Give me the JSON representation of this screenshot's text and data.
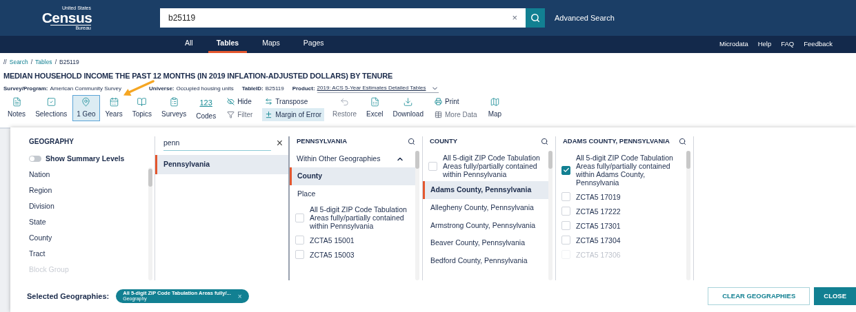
{
  "header": {
    "logo": {
      "top": "United States",
      "main": "Census",
      "bottom": "Bureau"
    },
    "search": {
      "value": "b25119",
      "clear": "×"
    },
    "advanced": "Advanced Search"
  },
  "nav": {
    "tabs": [
      {
        "label": "All",
        "selected": false
      },
      {
        "label": "Tables",
        "selected": true
      },
      {
        "label": "Maps",
        "selected": false
      },
      {
        "label": "Pages",
        "selected": false
      }
    ],
    "links": [
      "Microdata",
      "Help",
      "FAQ",
      "Feedback"
    ]
  },
  "breadcrumb": {
    "prefix": "//",
    "separator": "/",
    "items": [
      "Search",
      "Tables"
    ],
    "current": "B25119"
  },
  "title": "MEDIAN HOUSEHOLD INCOME THE PAST 12 MONTHS (IN 2019 INFLATION-ADJUSTED DOLLARS) BY TENURE",
  "meta": [
    {
      "label": "Survey/Program:",
      "value": "American Community Survey",
      "kind": "text"
    },
    {
      "label": "Universe:",
      "value": "Occupied housing units",
      "kind": "text"
    },
    {
      "label": "TableID:",
      "value": "B25119",
      "kind": "text"
    },
    {
      "label": "Product:",
      "value": "2019: ACS 5-Year Estimates Detailed Tables",
      "kind": "dropdown"
    }
  ],
  "toolbar": [
    {
      "kind": "tool",
      "label": "Notes",
      "selected": false,
      "disabled": false
    },
    {
      "kind": "tool",
      "label": "Selections",
      "selected": false,
      "disabled": false
    },
    {
      "kind": "tool",
      "label": "1 Geo",
      "selected": true,
      "disabled": false
    },
    {
      "kind": "tool",
      "label": "Years",
      "selected": false,
      "disabled": false
    },
    {
      "kind": "tool",
      "label": "Topics",
      "selected": false,
      "disabled": false
    },
    {
      "kind": "tool",
      "label": "Surveys",
      "selected": false,
      "disabled": false
    },
    {
      "kind": "code",
      "label": "Codes",
      "icon_text": "123",
      "selected": false,
      "disabled": false
    },
    {
      "kind": "stack",
      "items": [
        {
          "label": "Hide",
          "selected": false,
          "disabled": false
        },
        {
          "label": "Filter",
          "selected": false,
          "disabled": true
        }
      ]
    },
    {
      "kind": "stack",
      "items": [
        {
          "label": "Transpose",
          "selected": false,
          "disabled": false
        },
        {
          "label": "Margin of Error",
          "selected": true,
          "disabled": false
        }
      ]
    },
    {
      "kind": "tool",
      "label": "Restore",
      "selected": false,
      "disabled": true
    },
    {
      "kind": "tool",
      "label": "Excel",
      "selected": false,
      "disabled": false
    },
    {
      "kind": "tool",
      "label": "Download",
      "selected": false,
      "disabled": false
    },
    {
      "kind": "stack",
      "items": [
        {
          "label": "Print",
          "selected": false,
          "disabled": false
        },
        {
          "label": "More Data",
          "selected": false,
          "disabled": true
        }
      ]
    },
    {
      "kind": "tool",
      "label": "Map",
      "selected": false,
      "disabled": false
    }
  ],
  "geography": {
    "title": "GEOGRAPHY",
    "toggle": {
      "label": "Show Summary Levels",
      "on": false
    },
    "items": [
      {
        "label": "Nation",
        "dimmed": false
      },
      {
        "label": "Region",
        "dimmed": false
      },
      {
        "label": "Division",
        "dimmed": false
      },
      {
        "label": "State",
        "dimmed": false
      },
      {
        "label": "County",
        "dimmed": false
      },
      {
        "label": "Tract",
        "dimmed": false
      },
      {
        "label": "Block Group",
        "dimmed": true
      }
    ]
  },
  "filter": {
    "value": "penn",
    "clear": "×",
    "results": [
      {
        "label": "Pennsylvania",
        "selected": true
      }
    ]
  },
  "columns": [
    {
      "title": "PENNSYLVANIA",
      "group": {
        "label": "Within Other Geographies",
        "expanded": true
      },
      "items": [
        {
          "kind": "option",
          "label": "County",
          "selected": true,
          "dimmed": false
        },
        {
          "kind": "option",
          "label": "Place",
          "selected": false,
          "dimmed": false
        },
        {
          "kind": "check",
          "label": "All 5-digit ZIP Code Tabulation Areas fully/partially contained within Pennsylvania",
          "checked": false,
          "dimmed": false
        },
        {
          "kind": "check",
          "label": "ZCTA5 15001",
          "checked": false,
          "dimmed": false
        },
        {
          "kind": "check",
          "label": "ZCTA5 15003",
          "checked": false,
          "dimmed": false
        }
      ]
    },
    {
      "title": "COUNTY",
      "items": [
        {
          "kind": "check",
          "label": "All 5-digit ZIP Code Tabulation Areas fully/partially contained within Pennsylvania",
          "checked": false,
          "dimmed": false
        },
        {
          "kind": "option",
          "label": "Adams County, Pennsylvania",
          "selected": true,
          "dimmed": false
        },
        {
          "kind": "option",
          "label": "Allegheny County, Pennsylvania",
          "selected": false,
          "dimmed": false
        },
        {
          "kind": "option",
          "label": "Armstrong County, Pennsylvania",
          "selected": false,
          "dimmed": false
        },
        {
          "kind": "option",
          "label": "Beaver County, Pennsylvania",
          "selected": false,
          "dimmed": false
        },
        {
          "kind": "option",
          "label": "Bedford County, Pennsylvania",
          "selected": false,
          "dimmed": false
        }
      ]
    },
    {
      "title": "ADAMS COUNTY, PENNSYLVANIA",
      "items": [
        {
          "kind": "check",
          "label": "All 5-digit ZIP Code Tabulation Areas fully/partially contained within Adams County, Pennsylvania",
          "checked": true,
          "dimmed": false
        },
        {
          "kind": "check",
          "label": "ZCTA5 17019",
          "checked": false,
          "dimmed": false
        },
        {
          "kind": "check",
          "label": "ZCTA5 17222",
          "checked": false,
          "dimmed": false
        },
        {
          "kind": "check",
          "label": "ZCTA5 17301",
          "checked": false,
          "dimmed": false
        },
        {
          "kind": "check",
          "label": "ZCTA5 17304",
          "checked": false,
          "dimmed": false
        },
        {
          "kind": "check",
          "label": "ZCTA5 17306",
          "checked": false,
          "dimmed": true
        }
      ]
    }
  ],
  "footer": {
    "label": "Selected Geographies:",
    "chip": {
      "label": "All 5-digit ZIP Code Tabulation Areas fully/...",
      "sub": "Geography",
      "remove": "×"
    },
    "buttons": [
      {
        "label": "CLEAR GEOGRAPHIES",
        "kind": "outline"
      },
      {
        "label": "CLOSE",
        "kind": "solid"
      }
    ]
  }
}
